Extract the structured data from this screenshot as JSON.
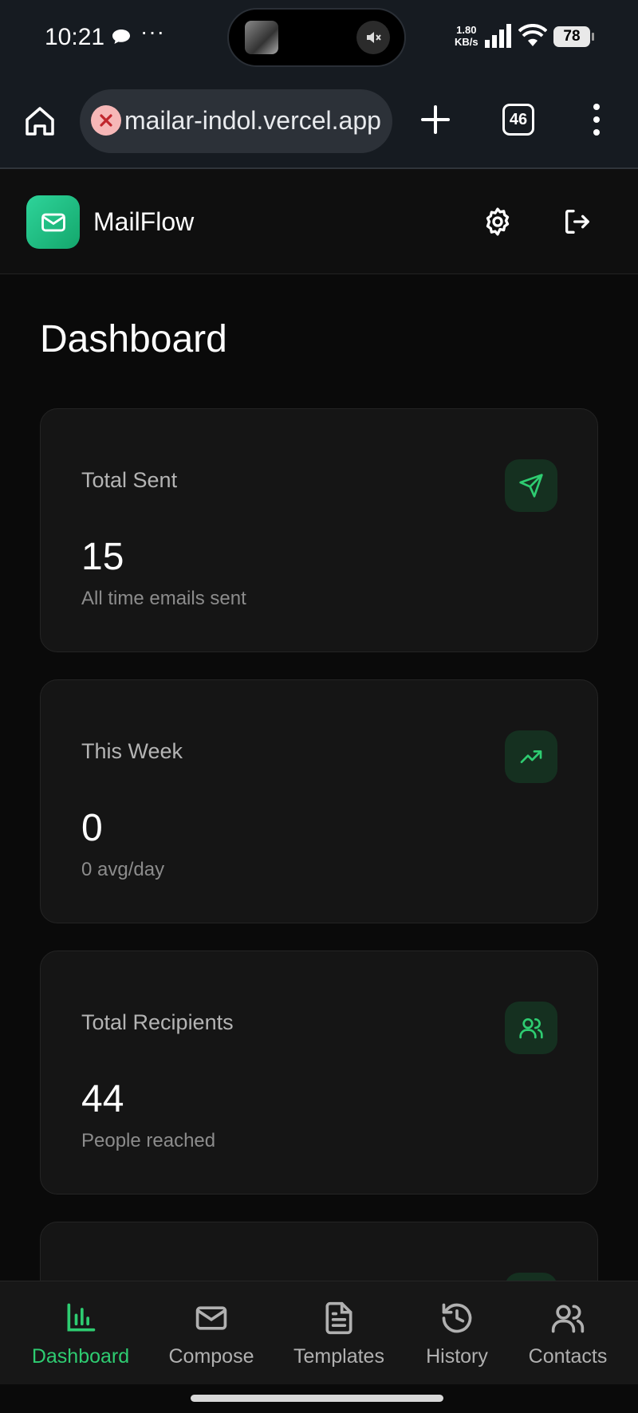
{
  "status_bar": {
    "time": "10:21",
    "dots": "···",
    "net_speed_value": "1.80",
    "net_speed_unit": "KB/s",
    "battery": "78"
  },
  "browser": {
    "url": "mailar-indol.vercel.app",
    "tab_count": "46"
  },
  "app": {
    "name": "MailFlow",
    "accent_color": "#2ecc71"
  },
  "page": {
    "title": "Dashboard"
  },
  "stats": [
    {
      "label": "Total Sent",
      "value": "15",
      "sub": "All time emails sent",
      "icon": "send-icon"
    },
    {
      "label": "This Week",
      "value": "0",
      "sub": "0 avg/day",
      "icon": "trending-up-icon"
    },
    {
      "label": "Total Recipients",
      "value": "44",
      "sub": "People reached",
      "icon": "users-icon"
    }
  ],
  "nav": [
    {
      "label": "Dashboard",
      "icon": "bar-chart-icon",
      "active": true
    },
    {
      "label": "Compose",
      "icon": "mail-icon",
      "active": false
    },
    {
      "label": "Templates",
      "icon": "file-text-icon",
      "active": false
    },
    {
      "label": "History",
      "icon": "history-icon",
      "active": false
    },
    {
      "label": "Contacts",
      "icon": "users-icon",
      "active": false
    }
  ]
}
